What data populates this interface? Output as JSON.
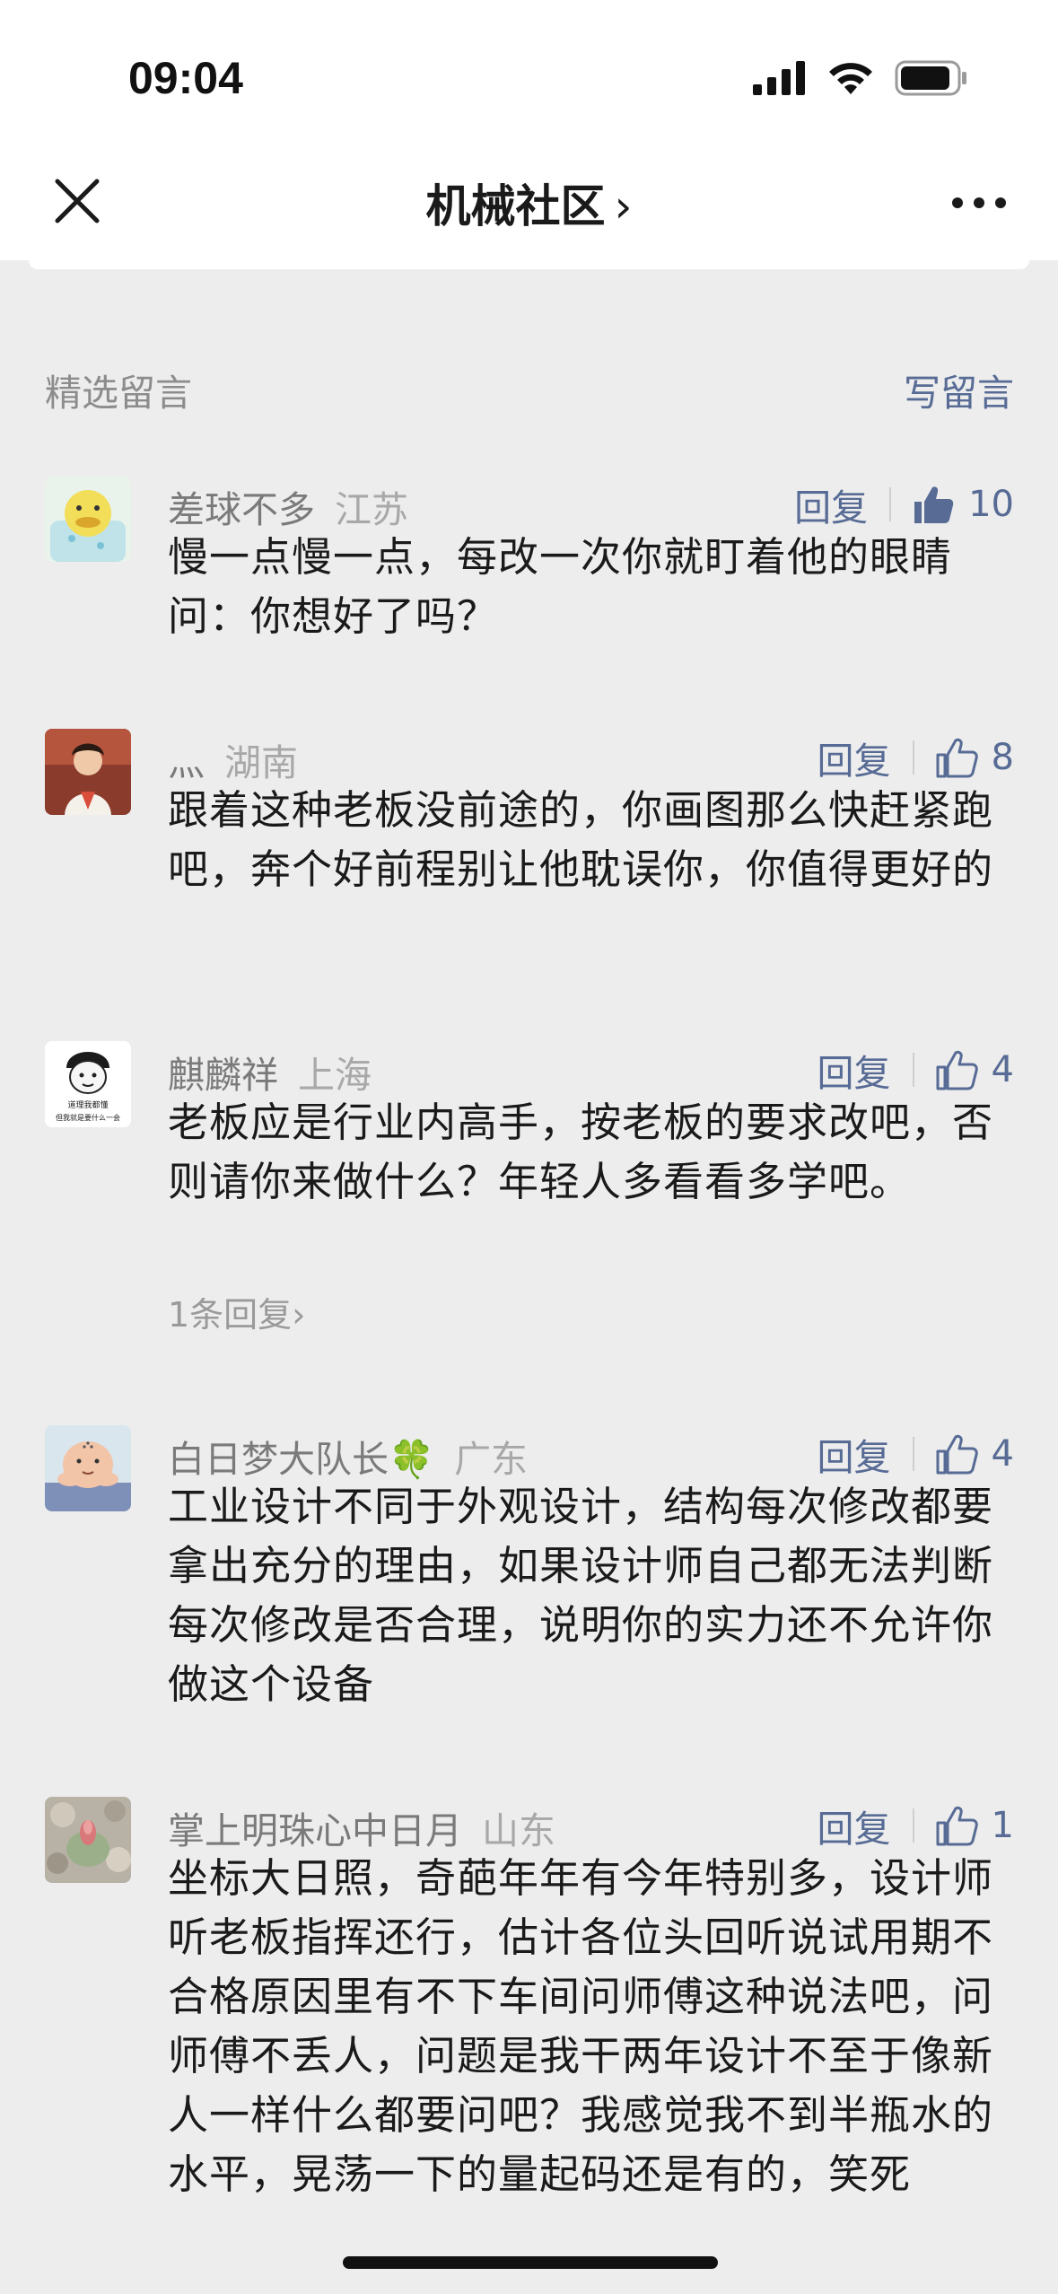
{
  "status_bar": {
    "time": "09:04"
  },
  "nav": {
    "title": "机械社区",
    "chevron": "›"
  },
  "section": {
    "title": "精选留言",
    "write_label": "写留言"
  },
  "reply_label": "回复",
  "comments": [
    {
      "nickname": "差球不多",
      "location": "江苏",
      "likes": "10",
      "liked": true,
      "text": "慢一点慢一点，每改一次你就盯着他的眼睛问：你想好了吗？"
    },
    {
      "nickname": "灬",
      "location": "湖南",
      "likes": "8",
      "liked": false,
      "text": "跟着这种老板没前途的，你画图那么快赶紧跑吧，奔个好前程别让他耽误你，你值得更好的"
    },
    {
      "nickname": "麒麟祥",
      "location": "上海",
      "likes": "4",
      "liked": false,
      "text": "老板应是行业内高手，按老板的要求改吧，否则请你来做什么？年轻人多看看多学吧。",
      "sub_replies": "1条回复",
      "avatar_caption_1": "道理我都懂",
      "avatar_caption_2": "但我就是要什么一会"
    },
    {
      "nickname": "白日梦大队长🍀",
      "location": "广东",
      "likes": "4",
      "liked": false,
      "text": "工业设计不同于外观设计，结构每次修改都要拿出充分的理由，如果设计师自己都无法判断每次修改是否合理，说明你的实力还不允许你做这个设备"
    },
    {
      "nickname": "掌上明珠心中日月",
      "location": "山东",
      "likes": "1",
      "liked": false,
      "text": "坐标大日照，奇葩年年有今年特别多，设计师听老板指挥还行，估计各位头回听说试用期不合格原因里有不下车间问师傅这种说法吧，问师傅不丢人，问题是我干两年设计不至于像新人一样什么都要问吧？我感觉我不到半瓶水的水平，晃荡一下的量起码还是有的，笑死"
    }
  ],
  "colors": {
    "link": "#576b95",
    "background": "#ededed",
    "header": "#ffffff"
  },
  "icons": [
    "close-icon",
    "more-icon",
    "thumbs-up-icon",
    "signal-icon",
    "wifi-icon",
    "battery-icon"
  ]
}
